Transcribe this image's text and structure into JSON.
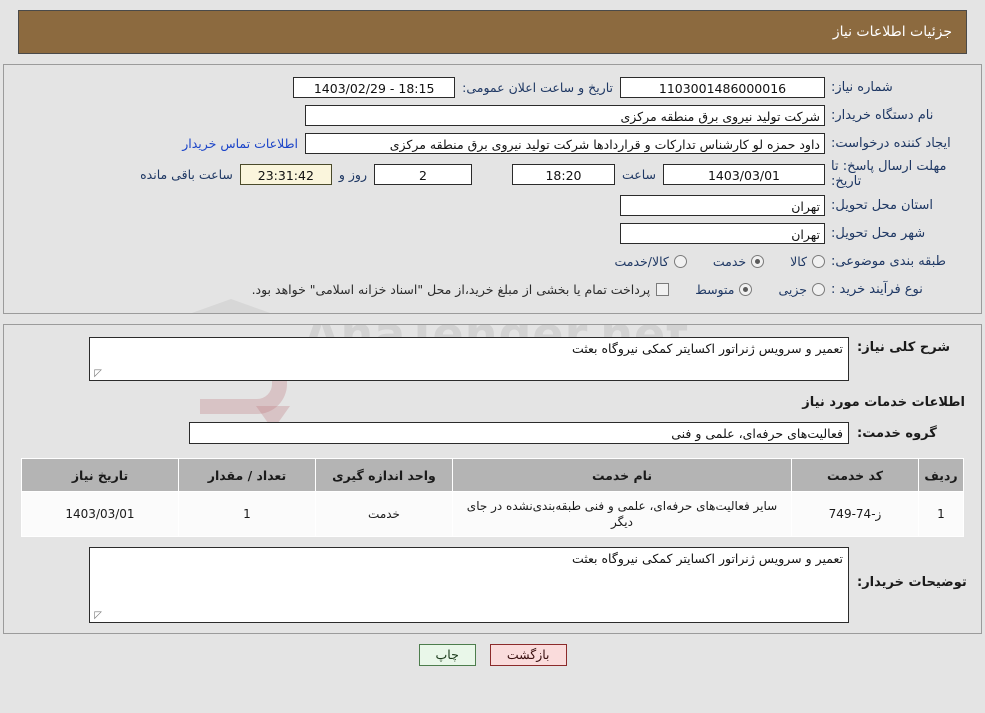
{
  "header": {
    "title": "جزئیات اطلاعات نیاز"
  },
  "form": {
    "need_number_label": "شماره نیاز:",
    "need_number_value": "1103001486000016",
    "announce_label": "تاریخ و ساعت اعلان عمومی:",
    "announce_value": "18:15 - 1403/02/29",
    "buyer_org_label": "نام دستگاه خریدار:",
    "buyer_org_value": "شرکت تولید نیروی برق منطقه مرکزی",
    "creator_label": "ایجاد کننده درخواست:",
    "creator_value": "داود حمزه لو کارشناس تدارکات و قراردادها شرکت تولید نیروی برق منطقه مرکزی",
    "contact_link": "اطلاعات تماس خریدار",
    "deadline_label": "مهلت ارسال پاسخ: تا تاریخ:",
    "deadline_date": "1403/03/01",
    "hour_label": "ساعت",
    "deadline_time": "18:20",
    "days_value": "2",
    "days_label": "روز و",
    "countdown_value": "23:31:42",
    "countdown_label": "ساعت باقی مانده",
    "province_label": "استان محل تحویل:",
    "province_value": "تهران",
    "city_label": "شهر محل تحویل:",
    "city_value": "تهران",
    "category_label": "طبقه بندی موضوعی:",
    "category_options": [
      {
        "label": "کالا",
        "selected": false
      },
      {
        "label": "خدمت",
        "selected": true
      },
      {
        "label": "کالا/خدمت",
        "selected": false
      }
    ],
    "process_label": "نوع فرآیند خرید :",
    "process_options": [
      {
        "label": "جزیی",
        "selected": false
      },
      {
        "label": "متوسط",
        "selected": true
      }
    ],
    "treasury_checkbox_label": "پرداخت تمام یا بخشی از مبلغ خرید،از محل \"اسناد خزانه اسلامی\" خواهد بود.",
    "treasury_checked": false
  },
  "details": {
    "need_desc_label": "شرح کلی نیاز:",
    "need_desc_value": "تعمیر و سرویس ژنراتور اکسایتر کمکی نیروگاه بعثت",
    "services_section_title": "اطلاعات خدمات مورد نیاز",
    "service_group_label": "گروه خدمت:",
    "service_group_value": "فعالیت‌های حرفه‌ای، علمی و فنی",
    "buyer_notes_label": "توضیحات خریدار:",
    "buyer_notes_value": "تعمیر و سرویس ژنراتور اکسایتر کمکی نیروگاه بعثت"
  },
  "table": {
    "columns": [
      "ردیف",
      "کد خدمت",
      "نام خدمت",
      "واحد اندازه گیری",
      "تعداد / مقدار",
      "تاریخ نیاز"
    ],
    "rows": [
      {
        "row": "1",
        "code": "ز-74-749",
        "name": "سایر فعالیت‌های حرفه‌ای، علمی و فنی طبقه‌بندی‌نشده در جای دیگر",
        "unit": "خدمت",
        "qty": "1",
        "date": "1403/03/01"
      }
    ]
  },
  "footer": {
    "print_label": "چاپ",
    "back_label": "بازگشت"
  },
  "watermark": {
    "text": "AnaTender.net"
  }
}
